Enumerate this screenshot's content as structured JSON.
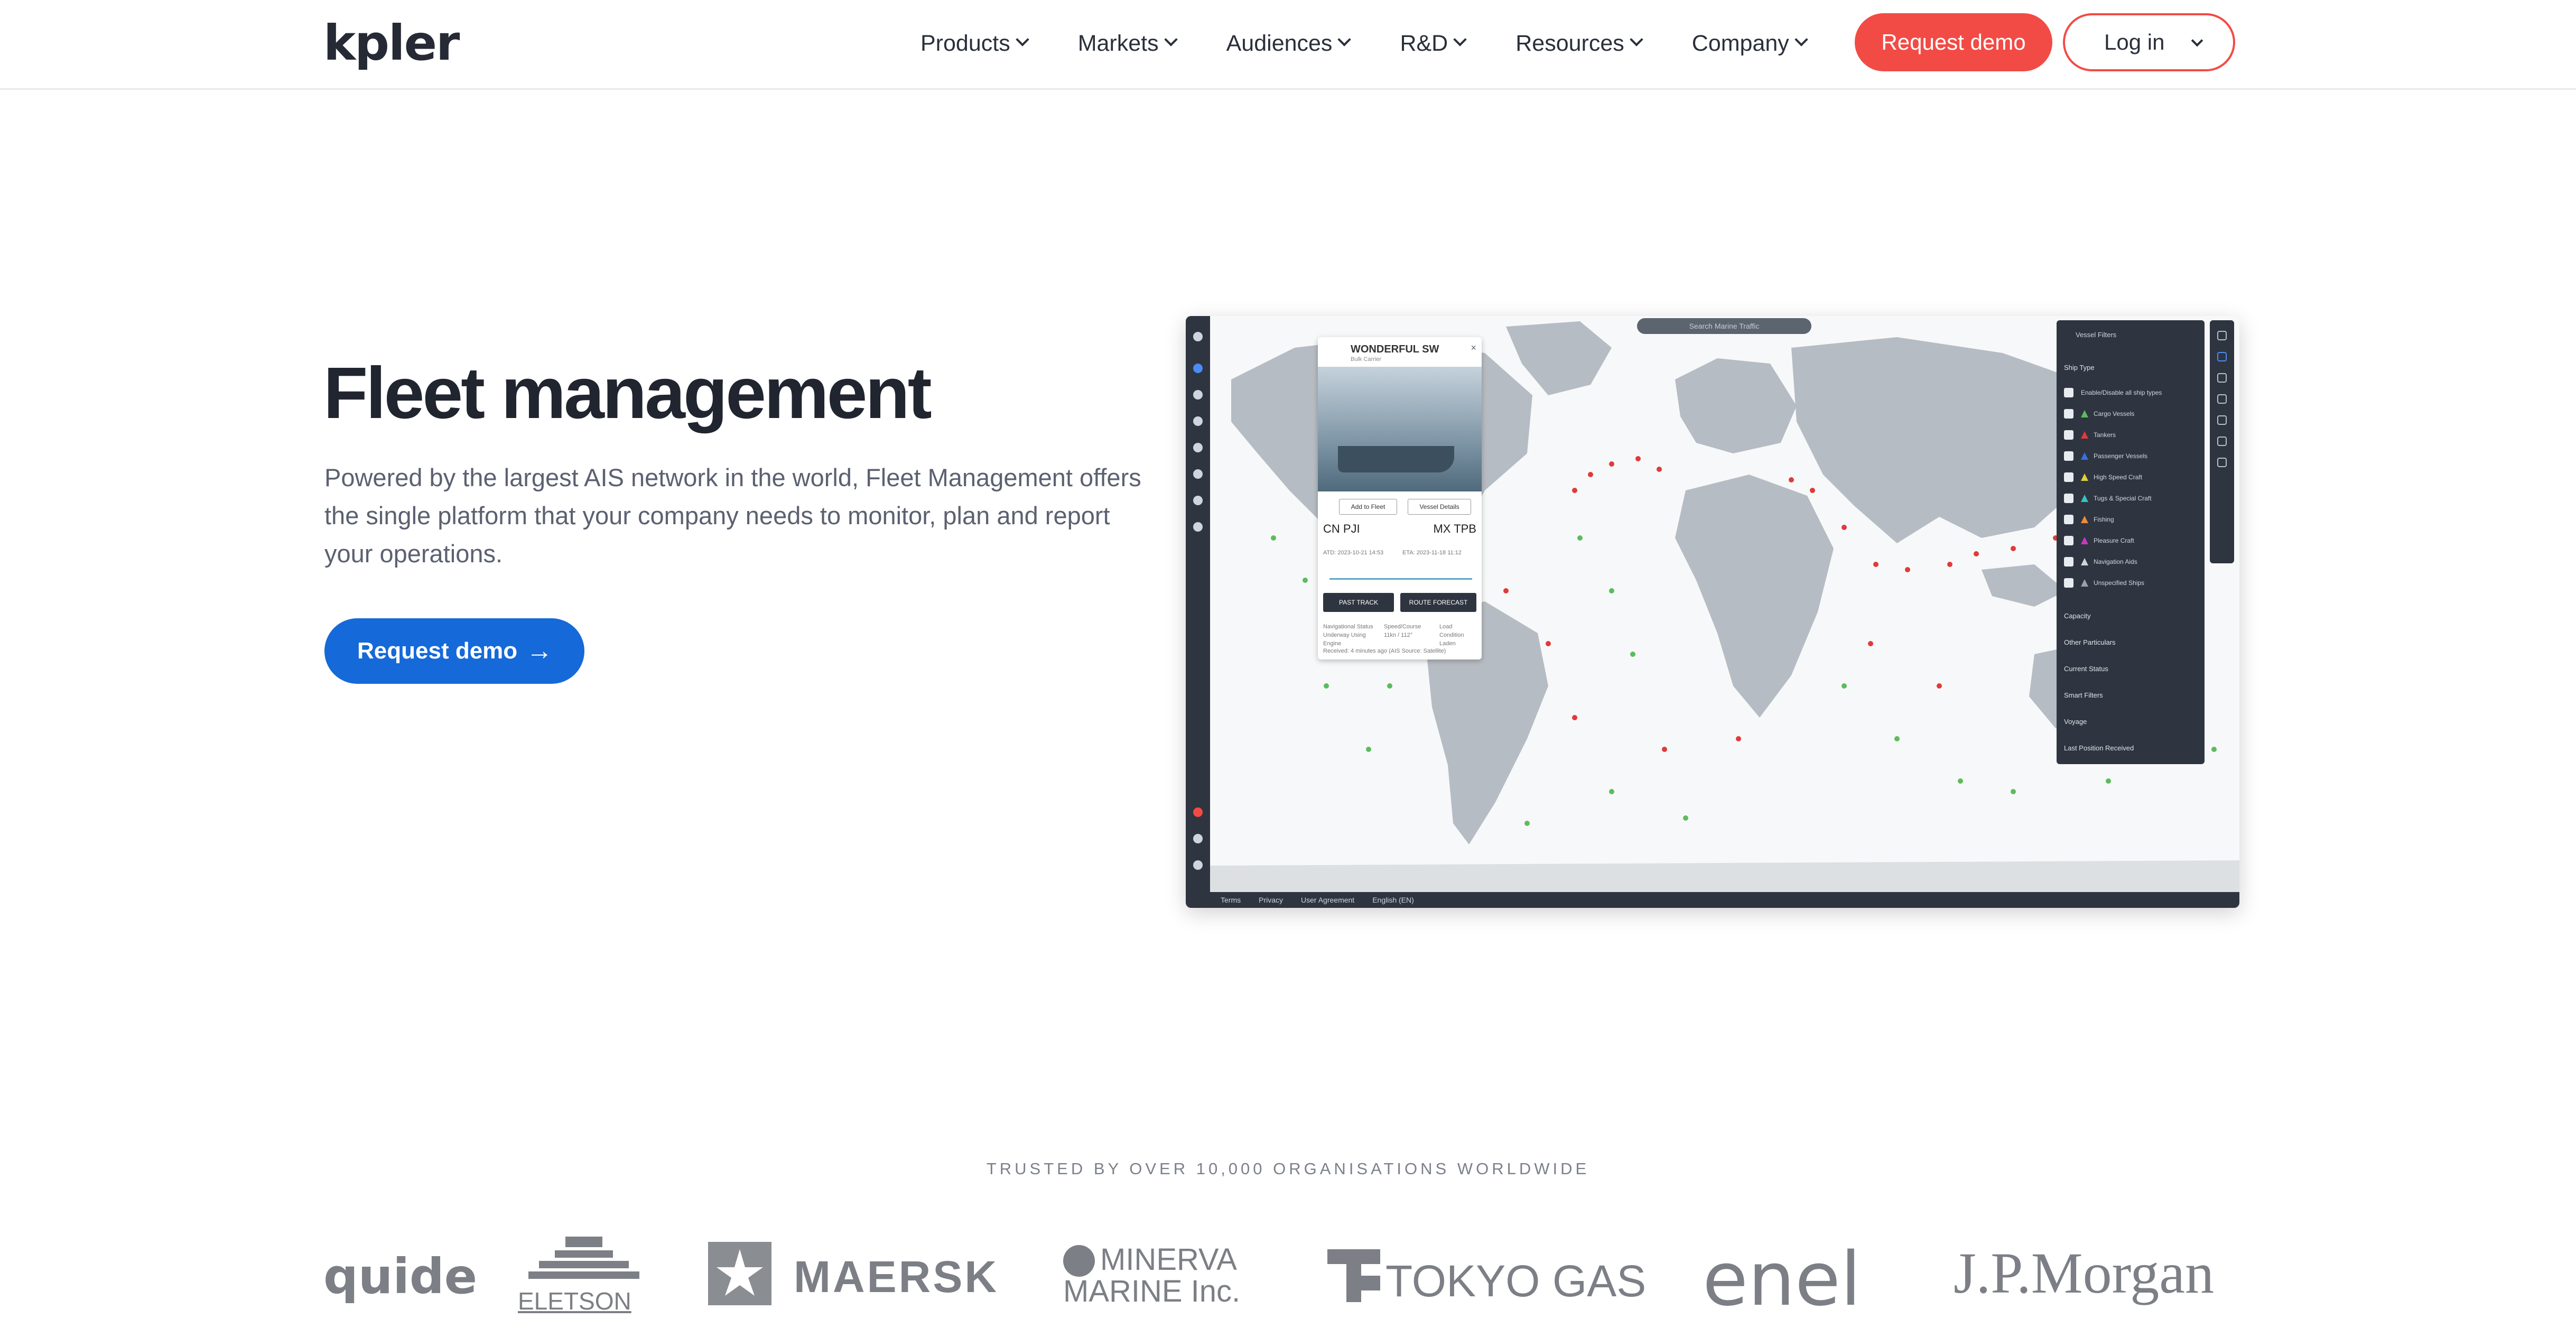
{
  "header": {
    "logo": "kpler",
    "nav": [
      "Products",
      "Markets",
      "Audiences",
      "R&D",
      "Resources",
      "Company"
    ],
    "request_demo": "Request demo",
    "login": "Log in"
  },
  "hero": {
    "title": "Fleet management",
    "description": "Powered by the largest AIS network in the world, Fleet Management offers the single platform that your company needs to monitor, plan and report your operations.",
    "cta": "Request demo",
    "cta_icon": "arrow-right-icon"
  },
  "app_screenshot": {
    "search_placeholder": "Search Marine Traffic",
    "vessel_card": {
      "name": "WONDERFUL SW",
      "subtitle": "Bulk Carrier",
      "add_to_fleet": "Add to Fleet",
      "vessel_details": "Vessel Details",
      "origin_port": "CN PJI",
      "destination_port": "MX TPB",
      "atd": "ATD: 2023-10-21 14:53",
      "eta": "ETA: 2023-11-18 11:12",
      "past_track": "PAST TRACK",
      "route_forecast": "ROUTE FORECAST",
      "nav_status_label": "Navigational Status",
      "nav_status": "Underway Using Engine",
      "speed_label": "Speed/Course",
      "speed": "11kn / 112°",
      "load_label": "Load Condition",
      "load": "Laden",
      "received": "Received: 4 minutes ago (AIS Source: Satellite)"
    },
    "filters": {
      "title": "Vessel Filters",
      "ship_type": "Ship Type",
      "items": [
        "Enable/Disable all ship types",
        "Cargo Vessels",
        "Tankers",
        "Passenger Vessels",
        "High Speed Craft",
        "Tugs & Special Craft",
        "Fishing",
        "Pleasure Craft",
        "Navigation Aids",
        "Unspecified Ships"
      ],
      "sections": [
        "Capacity",
        "Other Particulars",
        "Current Status",
        "Smart Filters",
        "Voyage",
        "Last Position Received"
      ]
    },
    "status_bar": [
      "Terms",
      "Privacy",
      "User Agreement",
      "English (EN)"
    ]
  },
  "trusted": {
    "label": "TRUSTED BY OVER 10,000 ORGANISATIONS WORLDWIDE",
    "logos": [
      "quide",
      "ELETSON",
      "MAERSK",
      "MINERVA",
      "MARINE Inc.",
      "TOKYO GAS",
      "enel",
      "J.P.Morgan"
    ]
  }
}
